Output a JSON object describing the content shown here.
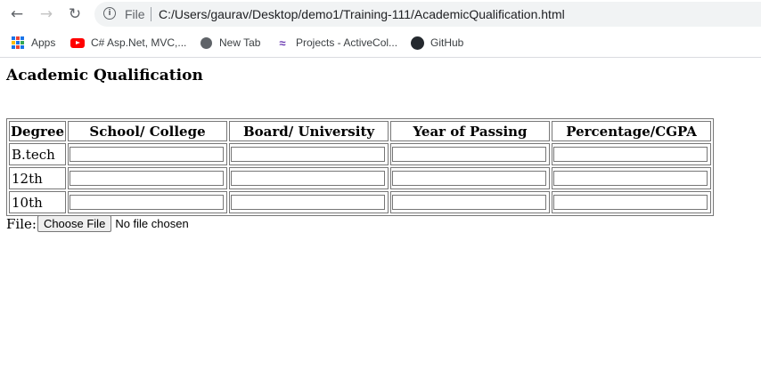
{
  "browser": {
    "scheme": "File",
    "url": "C:/Users/gaurav/Desktop/demo1/Training-111/AcademicQualification.html",
    "bookmarks": [
      {
        "label": "Apps",
        "icon": "apps-grid-icon"
      },
      {
        "label": "C# Asp.Net, MVC,...",
        "icon": "youtube-icon"
      },
      {
        "label": "New Tab",
        "icon": "globe-icon"
      },
      {
        "label": "Projects - ActiveCol...",
        "icon": "activecollab-icon"
      },
      {
        "label": "GitHub",
        "icon": "github-icon"
      }
    ]
  },
  "page": {
    "title": "Academic Qualification",
    "table": {
      "headers": [
        "Degree",
        "School/ College",
        "Board/ University",
        "Year of Passing",
        "Percentage/CGPA"
      ],
      "rows": [
        {
          "degree": "B.tech",
          "school": "",
          "board": "",
          "year": "",
          "percentage": ""
        },
        {
          "degree": "12th",
          "school": "",
          "board": "",
          "year": "",
          "percentage": ""
        },
        {
          "degree": "10th",
          "school": "",
          "board": "",
          "year": "",
          "percentage": ""
        }
      ]
    },
    "file": {
      "label": "File:",
      "button": "Choose File",
      "status": "No file chosen"
    }
  }
}
